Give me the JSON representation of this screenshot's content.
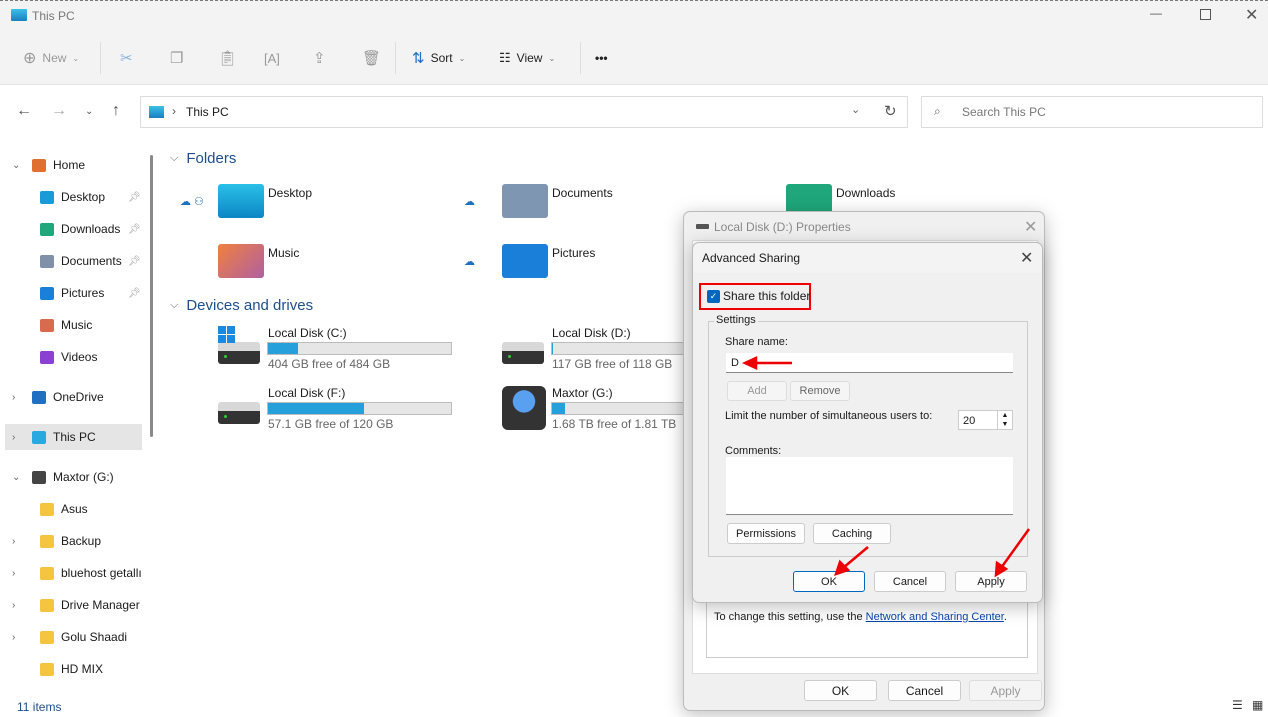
{
  "window": {
    "title": "This PC",
    "icon": "monitor-icon"
  },
  "toolbar": {
    "new": "New",
    "sort": "Sort",
    "view": "View",
    "more": "•••"
  },
  "address": {
    "path": "This PC",
    "search_placeholder": "Search This PC"
  },
  "sidebar": {
    "items": [
      {
        "label": "Home",
        "icon": "home-icon"
      },
      {
        "label": "Desktop",
        "icon": "desktop-icon",
        "pinned": true
      },
      {
        "label": "Downloads",
        "icon": "download-icon",
        "pinned": true
      },
      {
        "label": "Documents",
        "icon": "documents-icon",
        "pinned": true
      },
      {
        "label": "Pictures",
        "icon": "pictures-icon",
        "pinned": true
      },
      {
        "label": "Music",
        "icon": "music-icon"
      },
      {
        "label": "Videos",
        "icon": "videos-icon"
      },
      {
        "label": "OneDrive",
        "icon": "cloud-icon"
      },
      {
        "label": "This PC",
        "icon": "monitor-icon",
        "selected": true
      },
      {
        "label": "Maxtor (G:)",
        "icon": "drive-icon"
      },
      {
        "label": "Asus",
        "icon": "folder-icon"
      },
      {
        "label": "Backup",
        "icon": "folder-icon"
      },
      {
        "label": "bluehost getallı",
        "icon": "folder-icon"
      },
      {
        "label": "Drive Manager",
        "icon": "folder-icon"
      },
      {
        "label": "Golu Shaadi",
        "icon": "folder-icon"
      },
      {
        "label": "HD MIX",
        "icon": "folder-icon"
      }
    ]
  },
  "main": {
    "folders_heading": "Folders",
    "folders": [
      {
        "label": "Desktop"
      },
      {
        "label": "Documents"
      },
      {
        "label": "Downloads"
      },
      {
        "label": "Music"
      },
      {
        "label": "Pictures"
      }
    ],
    "drives_heading": "Devices and drives",
    "drives": [
      {
        "label": "Local Disk (C:)",
        "free": "404 GB free of 484 GB",
        "used_pct": 16.5
      },
      {
        "label": "Local Disk (D:)",
        "free": "117 GB free of 118 GB",
        "used_pct": 0.8
      },
      {
        "label": "Local Disk (F:)",
        "free": "57.1 GB free of 120 GB",
        "used_pct": 52.4
      },
      {
        "label": "Maxtor (G:)",
        "free": "1.68 TB free of 1.81 TB",
        "used_pct": 7.2
      }
    ]
  },
  "status": {
    "items": "11 items"
  },
  "properties": {
    "title": "Local Disk (D:) Properties",
    "note": "To change this setting, use the ",
    "link": "Network and Sharing Center",
    "period": ".",
    "ok": "OK",
    "cancel": "Cancel",
    "apply": "Apply"
  },
  "advanced": {
    "title": "Advanced Sharing",
    "share_checkbox": "Share this folder",
    "share_checked": true,
    "settings": "Settings",
    "share_name_label": "Share name:",
    "share_name": "D",
    "add": "Add",
    "remove": "Remove",
    "limit_label": "Limit the number of simultaneous users to:",
    "limit": "20",
    "comments_label": "Comments:",
    "comments": "",
    "permissions": "Permissions",
    "caching": "Caching",
    "ok": "OK",
    "cancel": "Cancel",
    "apply": "Apply"
  },
  "colors": {
    "accent": "#0067c0",
    "annotation": "#e00000",
    "bar": "#26a0da"
  }
}
